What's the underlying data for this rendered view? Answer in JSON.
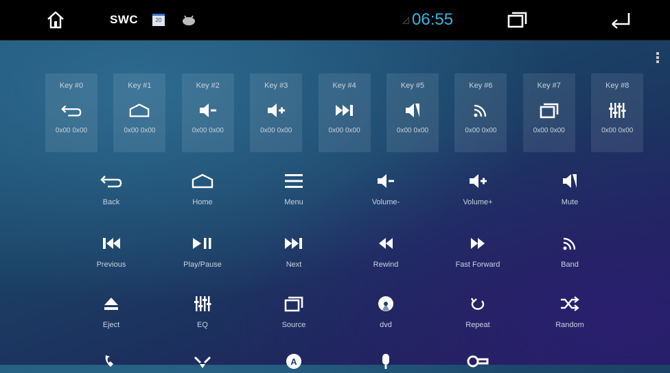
{
  "status_bar": {
    "swc_label": "SWC",
    "calendar_day": "20",
    "time": "06:55"
  },
  "keys": [
    {
      "label": "Key #0",
      "icon": "back-arrow-icon",
      "code": "0x00 0x00"
    },
    {
      "label": "Key #1",
      "icon": "home-icon",
      "code": "0x00 0x00"
    },
    {
      "label": "Key #2",
      "icon": "volume-down-icon",
      "code": "0x00 0x00"
    },
    {
      "label": "Key #3",
      "icon": "volume-up-icon",
      "code": "0x00 0x00"
    },
    {
      "label": "Key #4",
      "icon": "next-track-icon",
      "code": "0x00 0x00"
    },
    {
      "label": "Key #5",
      "icon": "mute-icon",
      "code": "0x00 0x00"
    },
    {
      "label": "Key #6",
      "icon": "band-icon",
      "code": "0x00 0x00"
    },
    {
      "label": "Key #7",
      "icon": "source-icon",
      "code": "0x00 0x00"
    },
    {
      "label": "Key #8",
      "icon": "equalizer-icon",
      "code": "0x00 0x00"
    }
  ],
  "functions": [
    {
      "label": "Back",
      "icon": "back-arrow-icon"
    },
    {
      "label": "Home",
      "icon": "home-icon"
    },
    {
      "label": "Menu",
      "icon": "menu-icon"
    },
    {
      "label": "Volume-",
      "icon": "volume-down-icon"
    },
    {
      "label": "Volume+",
      "icon": "volume-up-icon"
    },
    {
      "label": "Mute",
      "icon": "mute-icon"
    },
    {
      "label": "Previous",
      "icon": "previous-track-icon"
    },
    {
      "label": "Play/Pause",
      "icon": "play-pause-icon"
    },
    {
      "label": "Next",
      "icon": "next-track-icon"
    },
    {
      "label": "Rewind",
      "icon": "rewind-icon"
    },
    {
      "label": "Fast Forward",
      "icon": "fast-forward-icon"
    },
    {
      "label": "Band",
      "icon": "band-icon"
    },
    {
      "label": "Eject",
      "icon": "eject-icon"
    },
    {
      "label": "EQ",
      "icon": "equalizer-icon"
    },
    {
      "label": "Source",
      "icon": "source-icon"
    },
    {
      "label": "dvd",
      "icon": "dvd-icon"
    },
    {
      "label": "Repeat",
      "icon": "repeat-icon"
    },
    {
      "label": "Random",
      "icon": "shuffle-icon"
    }
  ],
  "partial_row_icons": [
    "phone-icon",
    "hang-up-icon",
    "navigation-icon",
    "microphone-icon",
    "key-icon"
  ],
  "colors": {
    "clock": "#33b5e5",
    "status_bar_bg": "#000000"
  }
}
